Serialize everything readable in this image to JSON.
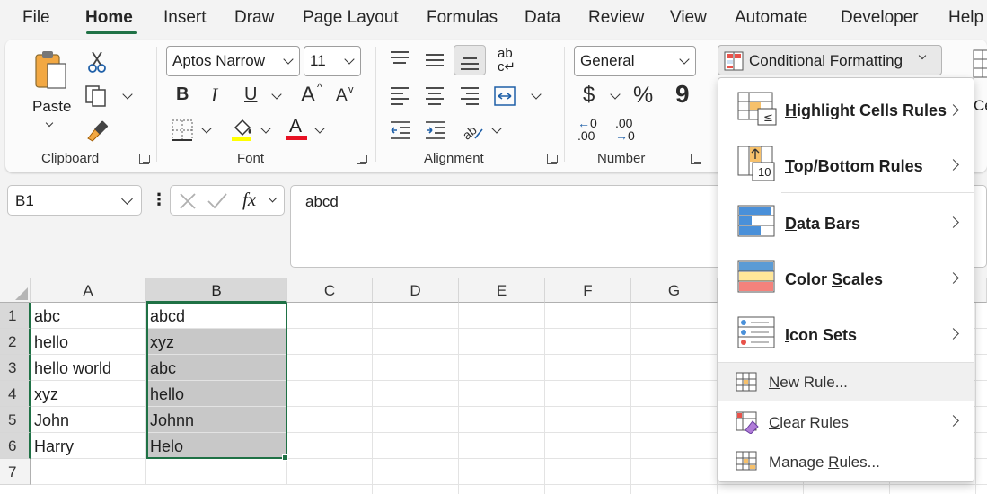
{
  "tabs": [
    "File",
    "Home",
    "Insert",
    "Draw",
    "Page Layout",
    "Formulas",
    "Data",
    "Review",
    "View",
    "Automate",
    "Developer",
    "Help"
  ],
  "ribbon": {
    "clipboard": {
      "paste": "Paste",
      "label": "Clipboard"
    },
    "font": {
      "name": "Aptos Narrow",
      "size": "11",
      "bold": "B",
      "italic": "I",
      "underline": "U",
      "grow": "A",
      "shrink": "A",
      "font_color": "A",
      "label": "Font"
    },
    "alignment": {
      "wrap": "ab",
      "label": "Alignment"
    },
    "number": {
      "format": "General",
      "currency": "$",
      "percent": "%",
      "comma": "9",
      "inc_dec": ".00",
      "dec_dec": ".00",
      "label": "Number"
    },
    "styles": {
      "conditional_formatting": "Conditional Formatting",
      "cell_styles": "Ce"
    }
  },
  "formula_bar": {
    "name_box": "B1",
    "fx": "fx",
    "content": "abcd"
  },
  "columns": [
    "A",
    "B",
    "C",
    "D",
    "E",
    "F",
    "G"
  ],
  "rows": [
    {
      "num": "1",
      "a": "abc",
      "b": "abcd"
    },
    {
      "num": "2",
      "a": "hello",
      "b": "xyz"
    },
    {
      "num": "3",
      "a": "hello world",
      "b": "abc"
    },
    {
      "num": "4",
      "a": "xyz",
      "b": "hello"
    },
    {
      "num": "5",
      "a": "John",
      "b": "Johnn"
    },
    {
      "num": "6",
      "a": "Harry",
      "b": "Helo"
    },
    {
      "num": "7",
      "a": "",
      "b": ""
    }
  ],
  "dropdown": {
    "highlight": {
      "u": "H",
      "rest": "ighlight Cells Rules"
    },
    "topbottom": {
      "u": "T",
      "rest": "op/Bottom Rules"
    },
    "databars": {
      "u": "D",
      "rest": "ata Bars"
    },
    "colorscales": {
      "pre": "Color ",
      "u": "S",
      "rest": "cales"
    },
    "iconsets": {
      "u": "I",
      "rest": "con Sets"
    },
    "newrule": {
      "u": "N",
      "rest": "ew Rule..."
    },
    "clearrules": {
      "u": "C",
      "rest": "lear Rules"
    },
    "managerules": {
      "pre": "Manage ",
      "u": "R",
      "rest": "ules..."
    },
    "topbottom_icon_text": "10"
  },
  "colors": {
    "accent": "#1f7145",
    "selection": "#c8c8c8",
    "highlight_fill": "#ffff00",
    "font_red": "#e81123"
  }
}
